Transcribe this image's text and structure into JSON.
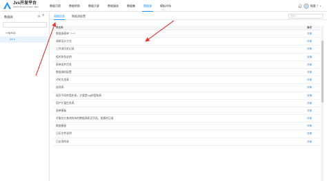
{
  "header": {
    "logo_title": "Jvs开发平台",
    "logo_subtitle": "RAPID BUILD EVERY IDEA",
    "nav": [
      "数据可视",
      "数据转换",
      "数据大屏",
      "数据服务",
      "数据集",
      "数据源",
      "模板市场"
    ],
    "active_nav_index": 5,
    "user_name": "周管 7"
  },
  "sidebar": {
    "title": "数据源",
    "search_placeholder": "",
    "tree": [
      {
        "label": "MySQL",
        "level": 0,
        "expanded": true
      },
      {
        "label": "jvs",
        "level": 1,
        "selected": true
      }
    ]
  },
  "main": {
    "tabs": [
      "表格信息",
      "数据源配置"
    ],
    "active_tab_index": 0,
    "search_placeholder": "请输入",
    "table": {
      "columns": {
        "name": "表名称",
        "op": "操作"
      },
      "rows": [
        "数据源表单（一）",
        "调研设计方式",
        "工作流历史记录",
        "相关联系说明",
        "表单组件信息",
        "数据源的配置",
        "代码生成表",
        "选项表",
        "网页不同的宽和高，主要是mg的宽和高",
        "用户扩展信息表",
        "表单模板",
        "对服务方查询所有的数据源表及字段，查看的记录",
        "数据模板",
        "日历文件说明",
        "日志用的表"
      ],
      "op_label": "详情"
    }
  },
  "colors": {
    "accent": "#1890ff",
    "annotation": "#e53935"
  }
}
